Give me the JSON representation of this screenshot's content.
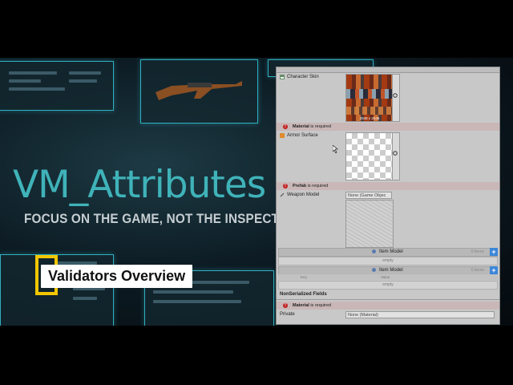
{
  "video": {
    "title": "VM_Attributes",
    "tagline": "FOCUS ON THE GAME, NOT THE INSPECTOR",
    "caption": "Validators Overview"
  },
  "inspector": {
    "character_skin_label": "Character Skin",
    "texture_size": "2048 x 2048",
    "material_required": "is required",
    "material_word": "Material",
    "armor_surface_label": "Armor Surface",
    "prefab_word": "Prefab",
    "prefab_required": "is required",
    "weapon_model_label": "Weapon Model",
    "weapon_model_value": "None (Game Objec",
    "item_model_1": "Item Model",
    "item_model_1_count": "0 items",
    "empty_1": "empty",
    "item_model_2": "Item Model",
    "item_model_2_count": "0 items",
    "col_key": "Key",
    "col_value": "Value",
    "empty_2": "empty",
    "nonserialized_header": "NonSerialized Fields",
    "material_word_2": "Material",
    "material_required_2": "is required",
    "private_label": "Private",
    "private_value": "None (Material)"
  }
}
